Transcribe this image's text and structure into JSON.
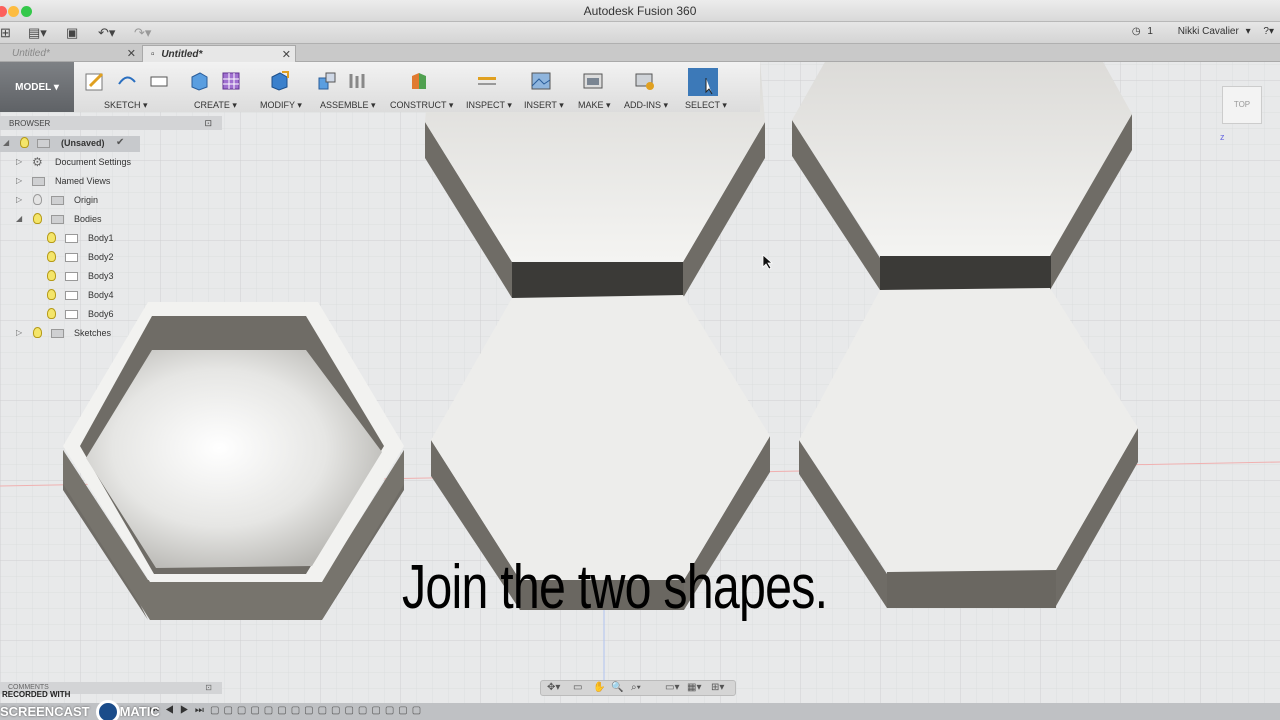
{
  "window": {
    "title": "Autodesk Fusion 360"
  },
  "quickbar": {
    "clock_count": "1",
    "user_name": "Nikki Cavalier",
    "help_icon": "help-icon"
  },
  "tabs": [
    {
      "label": "Untitled*",
      "active": false
    },
    {
      "label": "Untitled*",
      "active": true
    }
  ],
  "toolbar": {
    "workspace": "MODEL",
    "groups": [
      {
        "label": "SKETCH",
        "icon": "sketch-icon"
      },
      {
        "label": "CREATE",
        "icon": "create-icon"
      },
      {
        "label": "MODIFY",
        "icon": "modify-icon"
      },
      {
        "label": "ASSEMBLE",
        "icon": "assemble-icon"
      },
      {
        "label": "CONSTRUCT",
        "icon": "construct-icon"
      },
      {
        "label": "INSPECT",
        "icon": "inspect-icon"
      },
      {
        "label": "INSERT",
        "icon": "insert-icon"
      },
      {
        "label": "MAKE",
        "icon": "make-icon"
      },
      {
        "label": "ADD-INS",
        "icon": "add-ins-icon"
      },
      {
        "label": "SELECT",
        "icon": "select-icon"
      }
    ]
  },
  "browser": {
    "title": "BROWSER",
    "root": "(Unsaved)",
    "items": {
      "document_settings": "Document Settings",
      "named_views": "Named Views",
      "origin": "Origin",
      "bodies": "Bodies",
      "body1": "Body1",
      "body2": "Body2",
      "body3": "Body3",
      "body4": "Body4",
      "body6": "Body6",
      "sketches": "Sketches"
    }
  },
  "viewcube": {
    "face": "TOP"
  },
  "caption": "Join the two shapes.",
  "comments": {
    "title": "COMMENTS"
  },
  "watermark": {
    "line1": "RECORDED WITH",
    "line2": "SCREENCAST",
    "line3": "MATIC"
  },
  "colors": {
    "toolbar_model": "#6b6e72",
    "top_face": "#ececea",
    "side_face": "#6f6c66",
    "grid_bg": "#e8e9ea"
  }
}
